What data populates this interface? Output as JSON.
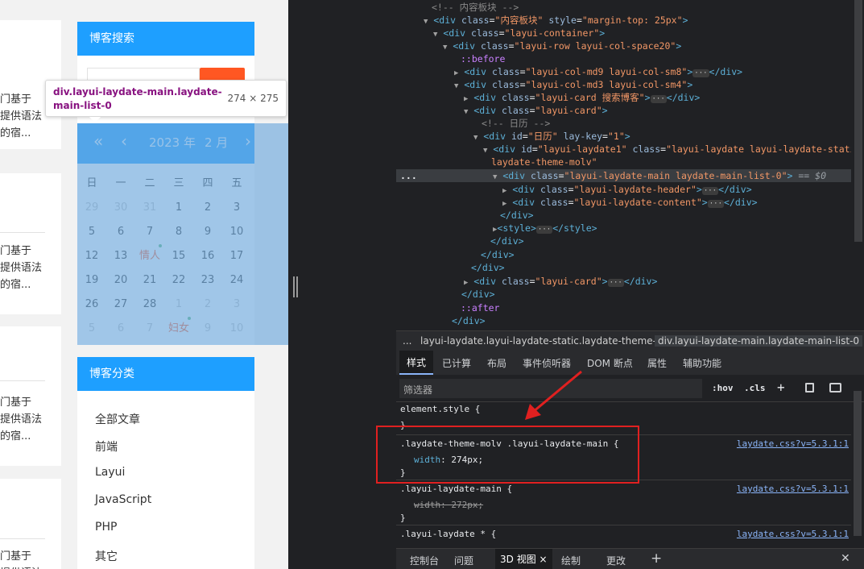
{
  "page": {
    "excerpt_lines": [
      "门基于",
      "提供语法",
      "的宿..."
    ],
    "search_card_title": "博客搜索",
    "category_card_title": "博客分类",
    "categories": [
      "全部文章",
      "前端",
      "Layui",
      "JavaScript",
      "PHP",
      "其它"
    ]
  },
  "tooltip": {
    "selector": "div.layui-laydate-main.laydate-main-list-0",
    "size": "274 × 275"
  },
  "calendar": {
    "year": "2023 年",
    "month": "2 月",
    "weekdays": [
      "日",
      "一",
      "二",
      "三",
      "四",
      "五"
    ],
    "rows": [
      [
        "29",
        "30",
        "31",
        "1",
        "2",
        "3"
      ],
      [
        "5",
        "6",
        "7",
        "8",
        "9",
        "10"
      ],
      [
        "12",
        "13",
        "情人",
        "15",
        "16",
        "17"
      ],
      [
        "19",
        "20",
        "21",
        "22",
        "23",
        "24"
      ],
      [
        "26",
        "27",
        "28",
        "1",
        "2",
        "3"
      ],
      [
        "5",
        "6",
        "7",
        "妇女",
        "9",
        "10"
      ]
    ]
  },
  "dom": {
    "l1_comment": "<!--  内容板块 -->",
    "l2_tag": "div",
    "l2_attr": "class",
    "l2_val": "\"内容板块\"",
    "l2_attr2": "style",
    "l2_val2": "\"margin-top: 25px\"",
    "l3_val": "\"layui-container\"",
    "l4_val": "\"layui-row layui-col-space20\"",
    "before": "::before",
    "l6_val": "\"layui-col-md9 layui-col-sm8\"",
    "l7_val": "\"layui-col-md3 layui-col-sm4\"",
    "l8_val": "\"layui-card 搜索博客\"",
    "l9_val": "\"layui-card\"",
    "l10_comment": "<!--  日历 -->",
    "l11_id": "\"日历\"",
    "l11_attr2": "lay-key",
    "l11_val2": "\"1\"",
    "l12_id": "\"layui-laydate1\"",
    "l12_val": "\"layui-laydate layui-laydate-static",
    "l13_cont": "laydate-theme-molv\"",
    "l14_val": "\"layui-laydate-main laydate-main-list-0\"",
    "l14_eq": "== $0",
    "l15_val": "\"layui-laydate-header\"",
    "l16_val": "\"layui-laydate-content\"",
    "close_div": "</div>",
    "style_tag": "style",
    "close_style": "</style>",
    "l22_val": "\"layui-card\"",
    "after": "::after",
    "gutter_dots": "..."
  },
  "breadcrumb": {
    "ellipsis": "...",
    "item1": "layui-laydate.layui-laydate-static.laydate-theme-molv",
    "item2": "div.layui-laydate-main.laydate-main-list-0"
  },
  "styles_tabs": [
    "样式",
    "已计算",
    "布局",
    "事件侦听器",
    "DOM 断点",
    "属性",
    "辅助功能"
  ],
  "filter": {
    "placeholder": "筛选器",
    "hov": ":hov",
    "cls": ".cls",
    "plus": "+"
  },
  "rules": {
    "r0_sel": "element.style {",
    "close": "}",
    "r1_sel": ".laydate-theme-molv .layui-laydate-main {",
    "r1_prop": "width",
    "r1_val": "274px;",
    "r1_src": "laydate.css?v=5.3.1:1",
    "r2_sel": ".layui-laydate-main {",
    "r2_decl": "width: 272px;",
    "r2_src": "laydate.css?v=5.3.1:1",
    "r3_sel": ".layui-laydate * {",
    "r3_src": "laydate.css?v=5.3.1:1"
  },
  "drawer_tabs": [
    "控制台",
    "问题",
    "3D 视图",
    "绘制",
    "更改"
  ],
  "drawer_close": "×",
  "drawer_add": "+",
  "drawer_x": "✕",
  "colors": {
    "accent": "#1e9fff",
    "search_button": "#ff5722",
    "annotation": "#e02020",
    "devtools_bg": "#202124"
  }
}
